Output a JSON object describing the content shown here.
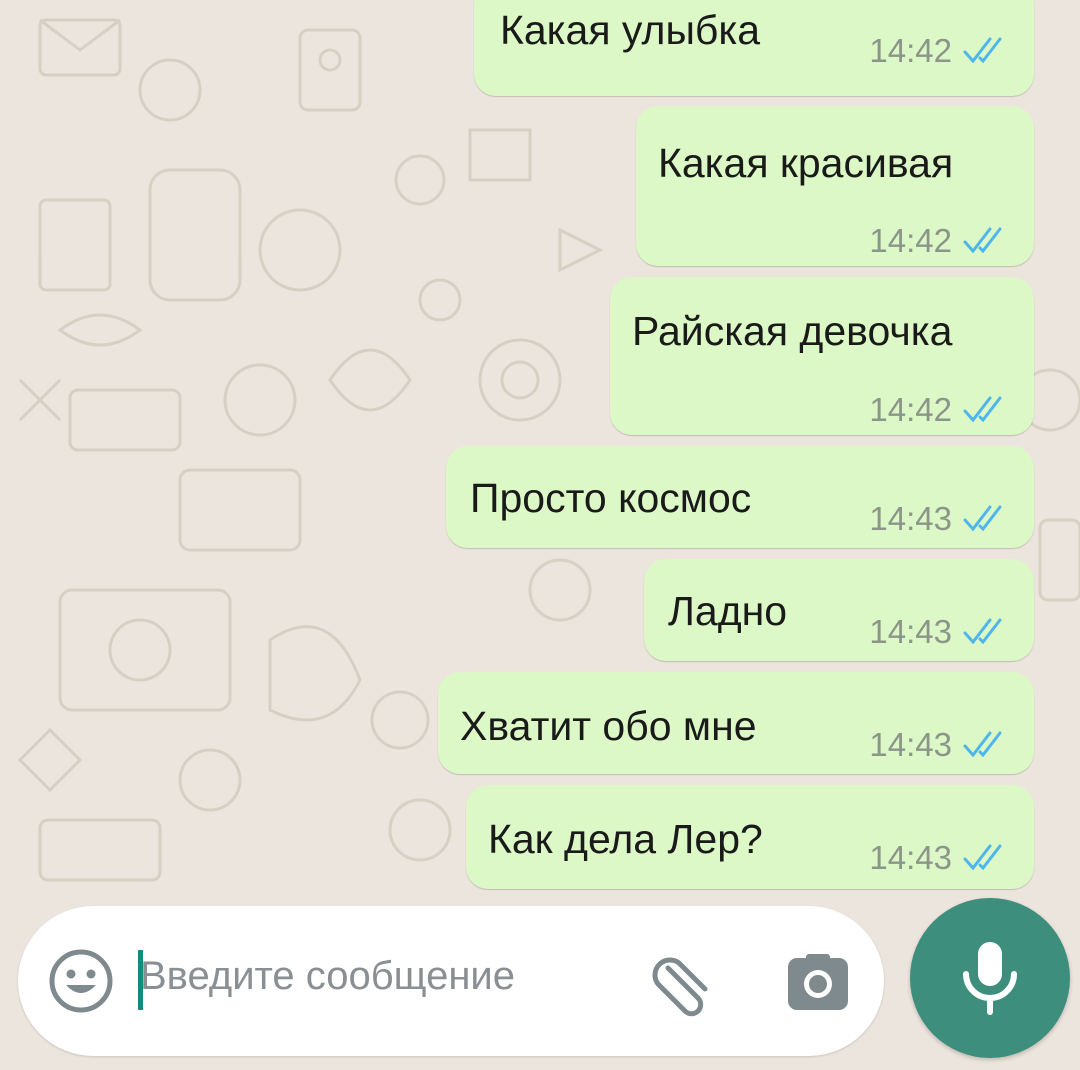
{
  "chat": {
    "messages": [
      {
        "text": "Какая улыбка",
        "time": "14:42",
        "status": "read"
      },
      {
        "text": "Какая красивая",
        "time": "14:42",
        "status": "read"
      },
      {
        "text": "Райская девочка",
        "time": "14:42",
        "status": "read"
      },
      {
        "text": "Просто космос",
        "time": "14:43",
        "status": "read"
      },
      {
        "text": "Ладно",
        "time": "14:43",
        "status": "read"
      },
      {
        "text": "Хватит обо мне",
        "time": "14:43",
        "status": "read"
      },
      {
        "text": "Как дела Лер?",
        "time": "14:43",
        "status": "read"
      }
    ]
  },
  "composer": {
    "placeholder": "Введите сообщение",
    "emoji_icon": "emoji-icon",
    "attach_icon": "paperclip-icon",
    "camera_icon": "camera-icon",
    "mic_icon": "microphone-icon"
  },
  "colors": {
    "outgoing_bubble": "#dcf8c6",
    "background": "#ece5dd",
    "read_ticks": "#4fb6ec",
    "mic_button": "#3e8e7e"
  }
}
